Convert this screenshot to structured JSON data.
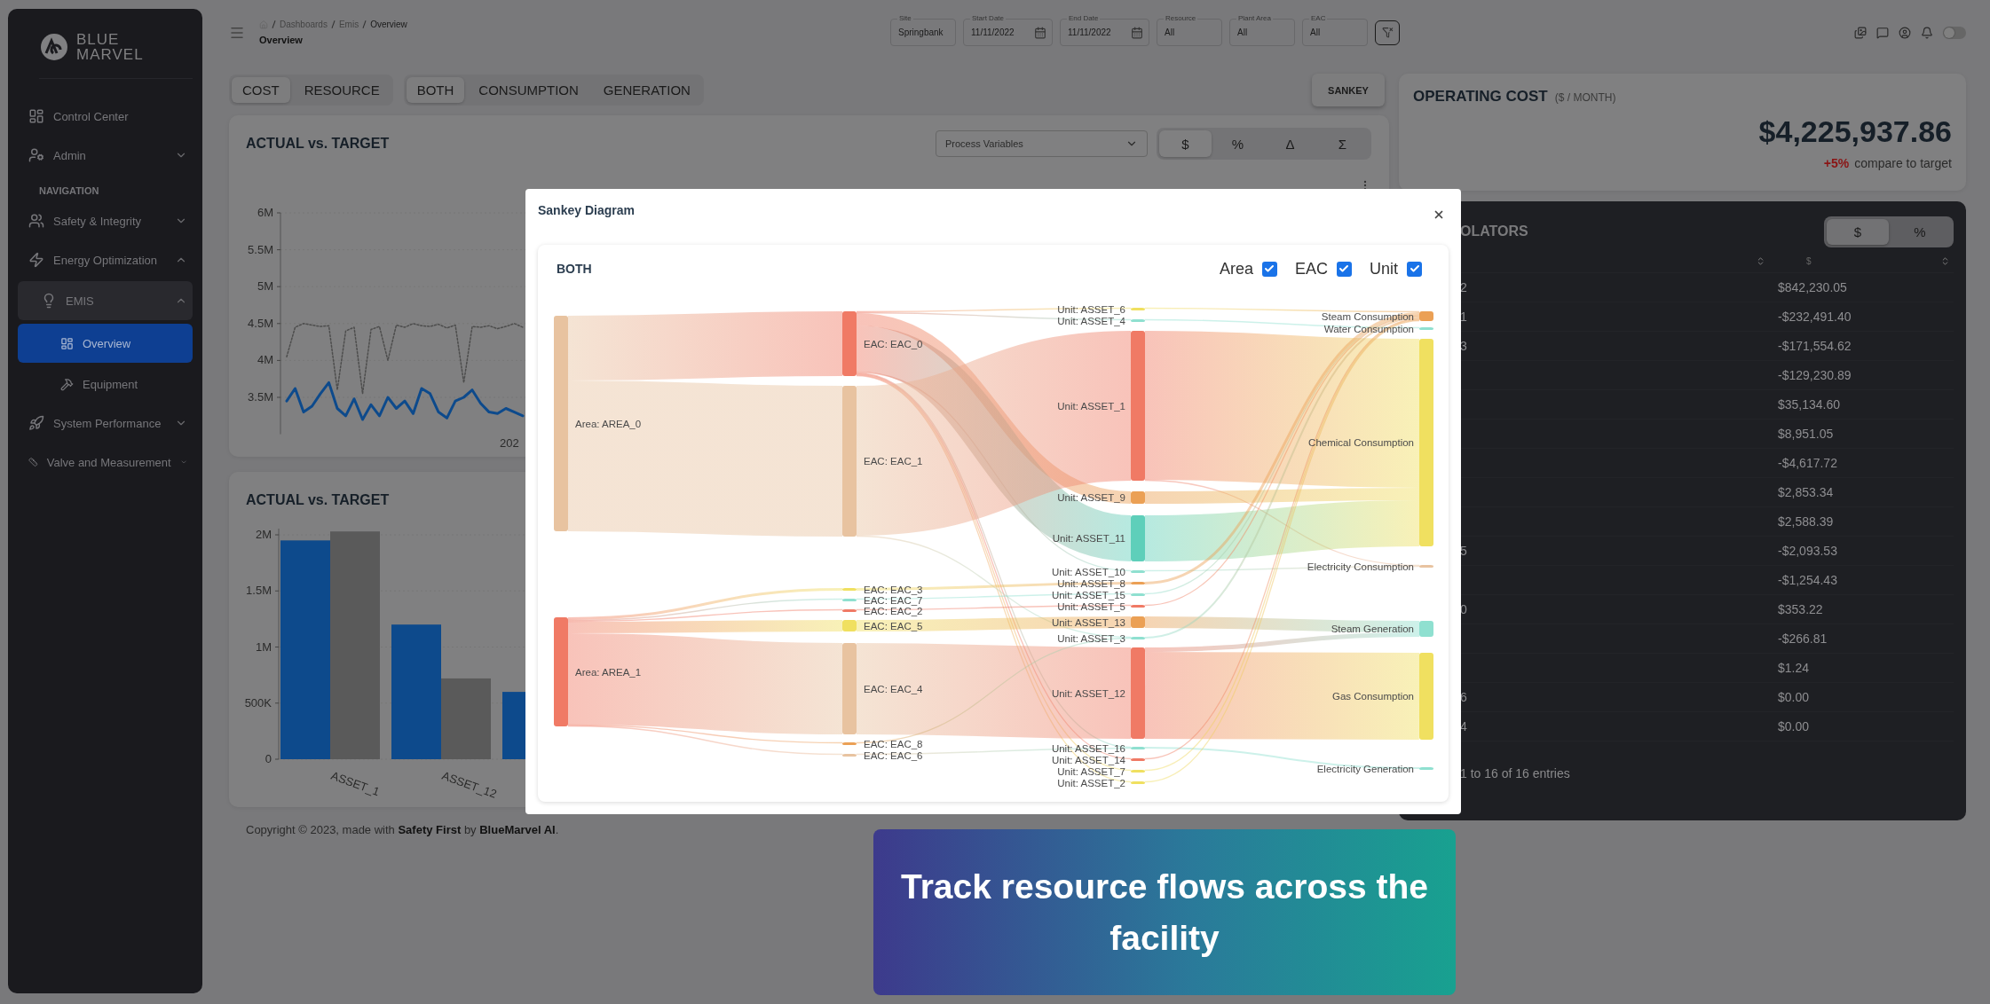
{
  "sidebar": {
    "logo": [
      "BLUE",
      "MARVEL"
    ],
    "items": [
      {
        "kind": "item",
        "label": "Control Center"
      },
      {
        "kind": "item",
        "label": "Admin",
        "expanded": false
      },
      {
        "kind": "section",
        "label": "NAVIGATION"
      },
      {
        "kind": "item",
        "label": "Safety & Integrity",
        "expanded": false
      },
      {
        "kind": "item",
        "label": "Energy Optimization",
        "expanded": true,
        "children": [
          {
            "label": "EMIS",
            "expanded": true,
            "children": [
              {
                "label": "Overview",
                "selected": true
              },
              {
                "label": "Equipment",
                "selected": false
              }
            ]
          }
        ]
      },
      {
        "kind": "item",
        "label": "System Performance",
        "expanded": false
      },
      {
        "kind": "item",
        "label": "Valve and Measurement",
        "expanded": false
      }
    ]
  },
  "header": {
    "breadcrumb": [
      "Dashboards",
      "Emis",
      "Overview"
    ],
    "page_title": "Overview",
    "filters": [
      {
        "kind": "text",
        "label": "Site",
        "value": "Springbank"
      },
      {
        "kind": "date",
        "label": "Start Date",
        "value": "11/11/2022"
      },
      {
        "kind": "date",
        "label": "End Date",
        "value": "11/11/2022"
      },
      {
        "kind": "text",
        "label": "Resource",
        "value": "All"
      },
      {
        "kind": "text",
        "label": "Plant Area",
        "value": "All"
      },
      {
        "kind": "text",
        "label": "EAC",
        "value": "All"
      }
    ],
    "theme_switch": {
      "on": false
    }
  },
  "mode_tabs": [
    {
      "label": "COST",
      "selected": true
    },
    {
      "label": "RESOURCE",
      "selected": false
    }
  ],
  "flow_tabs": [
    {
      "label": "BOTH",
      "selected": true
    },
    {
      "label": "CONSUMPTION",
      "selected": false
    },
    {
      "label": "GENERATION",
      "selected": false
    }
  ],
  "sankey_button": "SANKEY",
  "line_card": {
    "title": "ACTUAL vs. TARGET",
    "dropdown": "Process Variables",
    "units": [
      {
        "label": "$",
        "selected": true
      },
      {
        "label": "%",
        "selected": false
      },
      {
        "label": "Δ",
        "selected": false
      },
      {
        "label": "Σ",
        "selected": false
      }
    ],
    "x_label": "202",
    "chart_data": {
      "type": "line",
      "grid": true,
      "ylim": [
        3000000,
        6000000
      ],
      "yticks": [
        {
          "value": 3500000,
          "label": "3.5M"
        },
        {
          "value": 4000000,
          "label": "4M"
        },
        {
          "value": 4500000,
          "label": "4.5M"
        },
        {
          "value": 5000000,
          "label": "5M"
        },
        {
          "value": 5500000,
          "label": "5.5M"
        },
        {
          "value": 6000000,
          "label": "6M"
        }
      ],
      "series": [
        {
          "color": "#0d4a8c",
          "line_style": "solid",
          "values": [
            3450000,
            3620000,
            3300000,
            3380000,
            3550000,
            3700000,
            3350000,
            3250000,
            3480000,
            3200000,
            3400000,
            3250000,
            3500000,
            3350000,
            3450000,
            3280000,
            3620000,
            3550000,
            3300000,
            3220000,
            3450000,
            3500000,
            3600000,
            3420000,
            3300000,
            3280000,
            3350000,
            3300000,
            3250000
          ]
        },
        {
          "color": "#4d4d4d",
          "line_style": "dashed",
          "values": [
            4050000,
            4450000,
            4500000,
            4480000,
            4460000,
            4470000,
            3600000,
            4400000,
            4450000,
            3550000,
            4420000,
            4460000,
            4000000,
            4480000,
            4450000,
            4500000,
            4470000,
            4460000,
            4490000,
            4440000,
            4480000,
            3700000,
            4460000,
            4450000,
            4470000,
            4430000,
            4460000,
            4500000,
            4450000
          ]
        }
      ]
    }
  },
  "bar_card": {
    "title": "ACTUAL vs. TARGET",
    "chart_data": {
      "type": "bar",
      "grid": true,
      "ylim": [
        0,
        2100000
      ],
      "categories": [
        "ASSET_1",
        "ASSET_12",
        null
      ],
      "series": [
        {
          "color": "#0d4a8c",
          "values": [
            1950000,
            1200000,
            600000
          ]
        },
        {
          "color": "#5a5a5a",
          "values": [
            2030000,
            720000,
            null
          ]
        }
      ],
      "yticks": [
        {
          "value": 0,
          "label": "0"
        },
        {
          "value": 500000,
          "label": "500K"
        },
        {
          "value": 1000000,
          "label": "1M"
        },
        {
          "value": 1500000,
          "label": "1.5M"
        },
        {
          "value": 2000000,
          "label": "2M"
        }
      ]
    }
  },
  "footer": "Copyright © 2023, made with **Safety First** by **BlueMarvel AI**.",
  "operating_cost": {
    "title": "OPERATING COST",
    "unit": "($ / MONTH)",
    "value": "$4,225,937.86",
    "delta": "+5%",
    "delta_note": "compare to target"
  },
  "contributors": {
    "title": "OLATORS",
    "units": [
      {
        "label": "$",
        "selected": true
      },
      {
        "label": "%",
        "selected": false
      }
    ],
    "value_header": "$",
    "rows": [
      {
        "column_1": "2",
        "value": "$842,230.05"
      },
      {
        "column_1": "1",
        "value": "-$232,491.40"
      },
      {
        "column_1": "3",
        "value": "-$171,554.62"
      },
      {
        "value": "-$129,230.89"
      },
      {
        "value": "$35,134.60"
      },
      {
        "value": "$8,951.05"
      },
      {
        "value": "-$4,617.72"
      },
      {
        "value": "$2,853.34"
      },
      {
        "value": "$2,588.39"
      },
      {
        "column_1": "5",
        "value": "-$2,093.53"
      },
      {
        "value": "-$1,254.43"
      },
      {
        "column_1": "0",
        "value": "$353.22"
      },
      {
        "value": "-$266.81"
      },
      {
        "value": "$1.24"
      },
      {
        "column_1": "6",
        "value": "$0.00"
      },
      {
        "column_1": "4",
        "value": "$0.00"
      }
    ],
    "footer": "1 to 16 of 16 entries"
  },
  "modal": {
    "title": "Sankey Diagram",
    "card_title": "BOTH",
    "toggles": [
      {
        "label": "Area",
        "checked": true
      },
      {
        "label": "EAC",
        "checked": true
      },
      {
        "label": "Unit",
        "checked": true
      }
    ],
    "sankey": {
      "columns": [
        {
          "nodes": [
            {
              "label": "Area: AREA_0",
              "color": "#e8c3a0"
            },
            {
              "label": "Area: AREA_1",
              "color": "#f07a65"
            }
          ]
        },
        {
          "nodes": [
            {
              "label": "EAC: EAC_0",
              "color": "#f07a65"
            },
            {
              "label": "EAC: EAC_1",
              "color": "#e8c3a0"
            },
            {
              "label": "EAC: EAC_3",
              "color": "#f0e060"
            },
            {
              "label": "EAC: EAC_7",
              "color": "#8fe0d0"
            },
            {
              "label": "EAC: EAC_2",
              "color": "#f07a65"
            },
            {
              "label": "EAC: EAC_5",
              "color": "#f0e060"
            },
            {
              "label": "EAC: EAC_4",
              "color": "#e8c3a0"
            },
            {
              "label": "EAC: EAC_8",
              "color": "#eba055"
            },
            {
              "label": "EAC: EAC_6",
              "color": "#e8c3a0"
            }
          ]
        },
        {
          "nodes": [
            {
              "label": "Unit: ASSET_6",
              "color": "#f0e060"
            },
            {
              "label": "Unit: ASSET_4",
              "color": "#8fe0d0"
            },
            {
              "label": "Unit: ASSET_1",
              "color": "#f07a65"
            },
            {
              "label": "Unit: ASSET_9",
              "color": "#eba055"
            },
            {
              "label": "Unit: ASSET_11",
              "color": "#5ecfba"
            },
            {
              "label": "Unit: ASSET_10",
              "color": "#8fe0d0"
            },
            {
              "label": "Unit: ASSET_8",
              "color": "#eba055"
            },
            {
              "label": "Unit: ASSET_15",
              "color": "#8fe0d0"
            },
            {
              "label": "Unit: ASSET_5",
              "color": "#f07a65"
            },
            {
              "label": "Unit: ASSET_13",
              "color": "#eba055"
            },
            {
              "label": "Unit: ASSET_3",
              "color": "#8fe0d0"
            },
            {
              "label": "Unit: ASSET_12",
              "color": "#f07a65"
            },
            {
              "label": "Unit: ASSET_16",
              "color": "#8fe0d0"
            },
            {
              "label": "Unit: ASSET_14",
              "color": "#f07a65"
            },
            {
              "label": "Unit: ASSET_7",
              "color": "#f0e060"
            },
            {
              "label": "Unit: ASSET_2",
              "color": "#f0e060"
            }
          ]
        },
        {
          "nodes": [
            {
              "label": "Steam Consumption",
              "color": "#eba055"
            },
            {
              "label": "Water Consumption",
              "color": "#8fe0d0"
            },
            {
              "label": "Chemical Consumption",
              "color": "#f0e060"
            },
            {
              "label": "Electricity Consumption",
              "color": "#e8c3a0"
            },
            {
              "label": "Steam Generation",
              "color": "#8fe0d0"
            },
            {
              "label": "Gas Consumption",
              "color": "#f0e060"
            },
            {
              "label": "Electricity Generation",
              "color": "#8fe0d0"
            }
          ]
        }
      ]
    }
  },
  "caption": "Track resource flows across the facility"
}
